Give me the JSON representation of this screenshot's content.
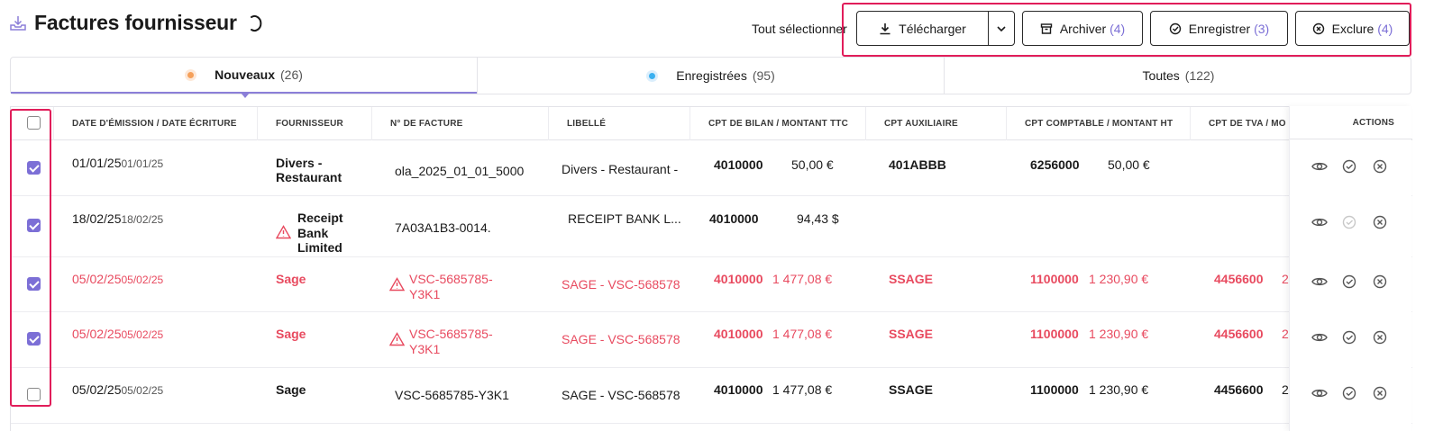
{
  "header": {
    "title": "Factures fournisseur",
    "select_all": "Tout sélectionner",
    "buttons": {
      "download": "Télécharger",
      "archive": "Archiver",
      "archive_count": "(4)",
      "register": "Enregistrer",
      "register_count": "(3)",
      "exclude": "Exclure",
      "exclude_count": "(4)"
    }
  },
  "tabs": [
    {
      "label": "Nouveaux",
      "count": "(26)",
      "dot_color": "#f5a05a"
    },
    {
      "label": "Enregistrées",
      "count": "(95)",
      "dot_color": "#3ab0f0"
    },
    {
      "label": "Toutes",
      "count": "(122)"
    }
  ],
  "columns": {
    "date": "DATE D'ÉMISSION / DATE ÉCRITURE",
    "supplier": "FOURNISSEUR",
    "invoice_no": "N° DE FACTURE",
    "label": "LIBELLÉ",
    "balance": "CPT DE BILAN / MONTANT TTC",
    "aux": "CPT AUXILIAIRE",
    "accounting": "CPT COMPTABLE / MONTANT HT",
    "vat": "CPT DE TVA / MO",
    "actions": "ACTIONS"
  },
  "rows": [
    {
      "checked": true,
      "date": "01/01/25",
      "date2": "01/01/25",
      "supplier": "Divers - Restaurant",
      "supplier_l1": "Divers -",
      "supplier_l2": "Restaurant",
      "invoice": "ola_2025_01_01_5000",
      "label": "Divers - Restaurant -",
      "balance_acct": "4010000",
      "balance_amt": "50,00 €",
      "aux": "401ABBB",
      "acct": "6256000",
      "acct_amt": "50,00 €",
      "vat_acct": "",
      "vat_amt": "",
      "error": false
    },
    {
      "checked": true,
      "date": "18/02/25",
      "date2": "18/02/25",
      "supplier_l1": "Receipt",
      "supplier_l2": "Bank",
      "supplier_l3": "Limited",
      "invoice": "7A03A1B3-0014.",
      "label": "RECEIPT BANK L...",
      "balance_acct": "4010000",
      "balance_amt": "94,43 $",
      "aux": "",
      "acct": "",
      "acct_amt": "",
      "vat_acct": "",
      "vat_amt": "",
      "error": false
    },
    {
      "checked": true,
      "date": "05/02/25",
      "date2": "05/02/25",
      "supplier": "Sage",
      "invoice_l1": "VSC-5685785-",
      "invoice_l2": "Y3K1",
      "label": "SAGE - VSC-568578",
      "balance_acct": "4010000",
      "balance_amt": "1 477,08 €",
      "aux": "SSAGE",
      "acct": "1100000",
      "acct_amt": "1 230,90 €",
      "vat_acct": "4456600",
      "vat_amt": "2",
      "error": true
    },
    {
      "checked": true,
      "date": "05/02/25",
      "date2": "05/02/25",
      "supplier": "Sage",
      "invoice_l1": "VSC-5685785-",
      "invoice_l2": "Y3K1",
      "label": "SAGE - VSC-568578",
      "balance_acct": "4010000",
      "balance_amt": "1 477,08 €",
      "aux": "SSAGE",
      "acct": "1100000",
      "acct_amt": "1 230,90 €",
      "vat_acct": "4456600",
      "vat_amt": "2",
      "error": true
    },
    {
      "checked": false,
      "date": "05/02/25",
      "date2": "05/02/25",
      "supplier": "Sage",
      "invoice": "VSC-5685785-Y3K1",
      "label": "SAGE - VSC-568578",
      "balance_acct": "4010000",
      "balance_amt": "1 477,08 €",
      "aux": "SSAGE",
      "acct": "1100000",
      "acct_amt": "1 230,90 €",
      "vat_acct": "4456600",
      "vat_amt": "2",
      "error": false
    }
  ],
  "colors": {
    "accent": "#7c6fd6",
    "error": "#e84a5f",
    "highlight_frame": "#e11d5a"
  },
  "icons": [
    "download-icon",
    "chevron-down-icon",
    "archive-icon",
    "check-circle-icon",
    "x-circle-icon",
    "eye-icon",
    "warning-icon",
    "inbox-download-icon"
  ]
}
